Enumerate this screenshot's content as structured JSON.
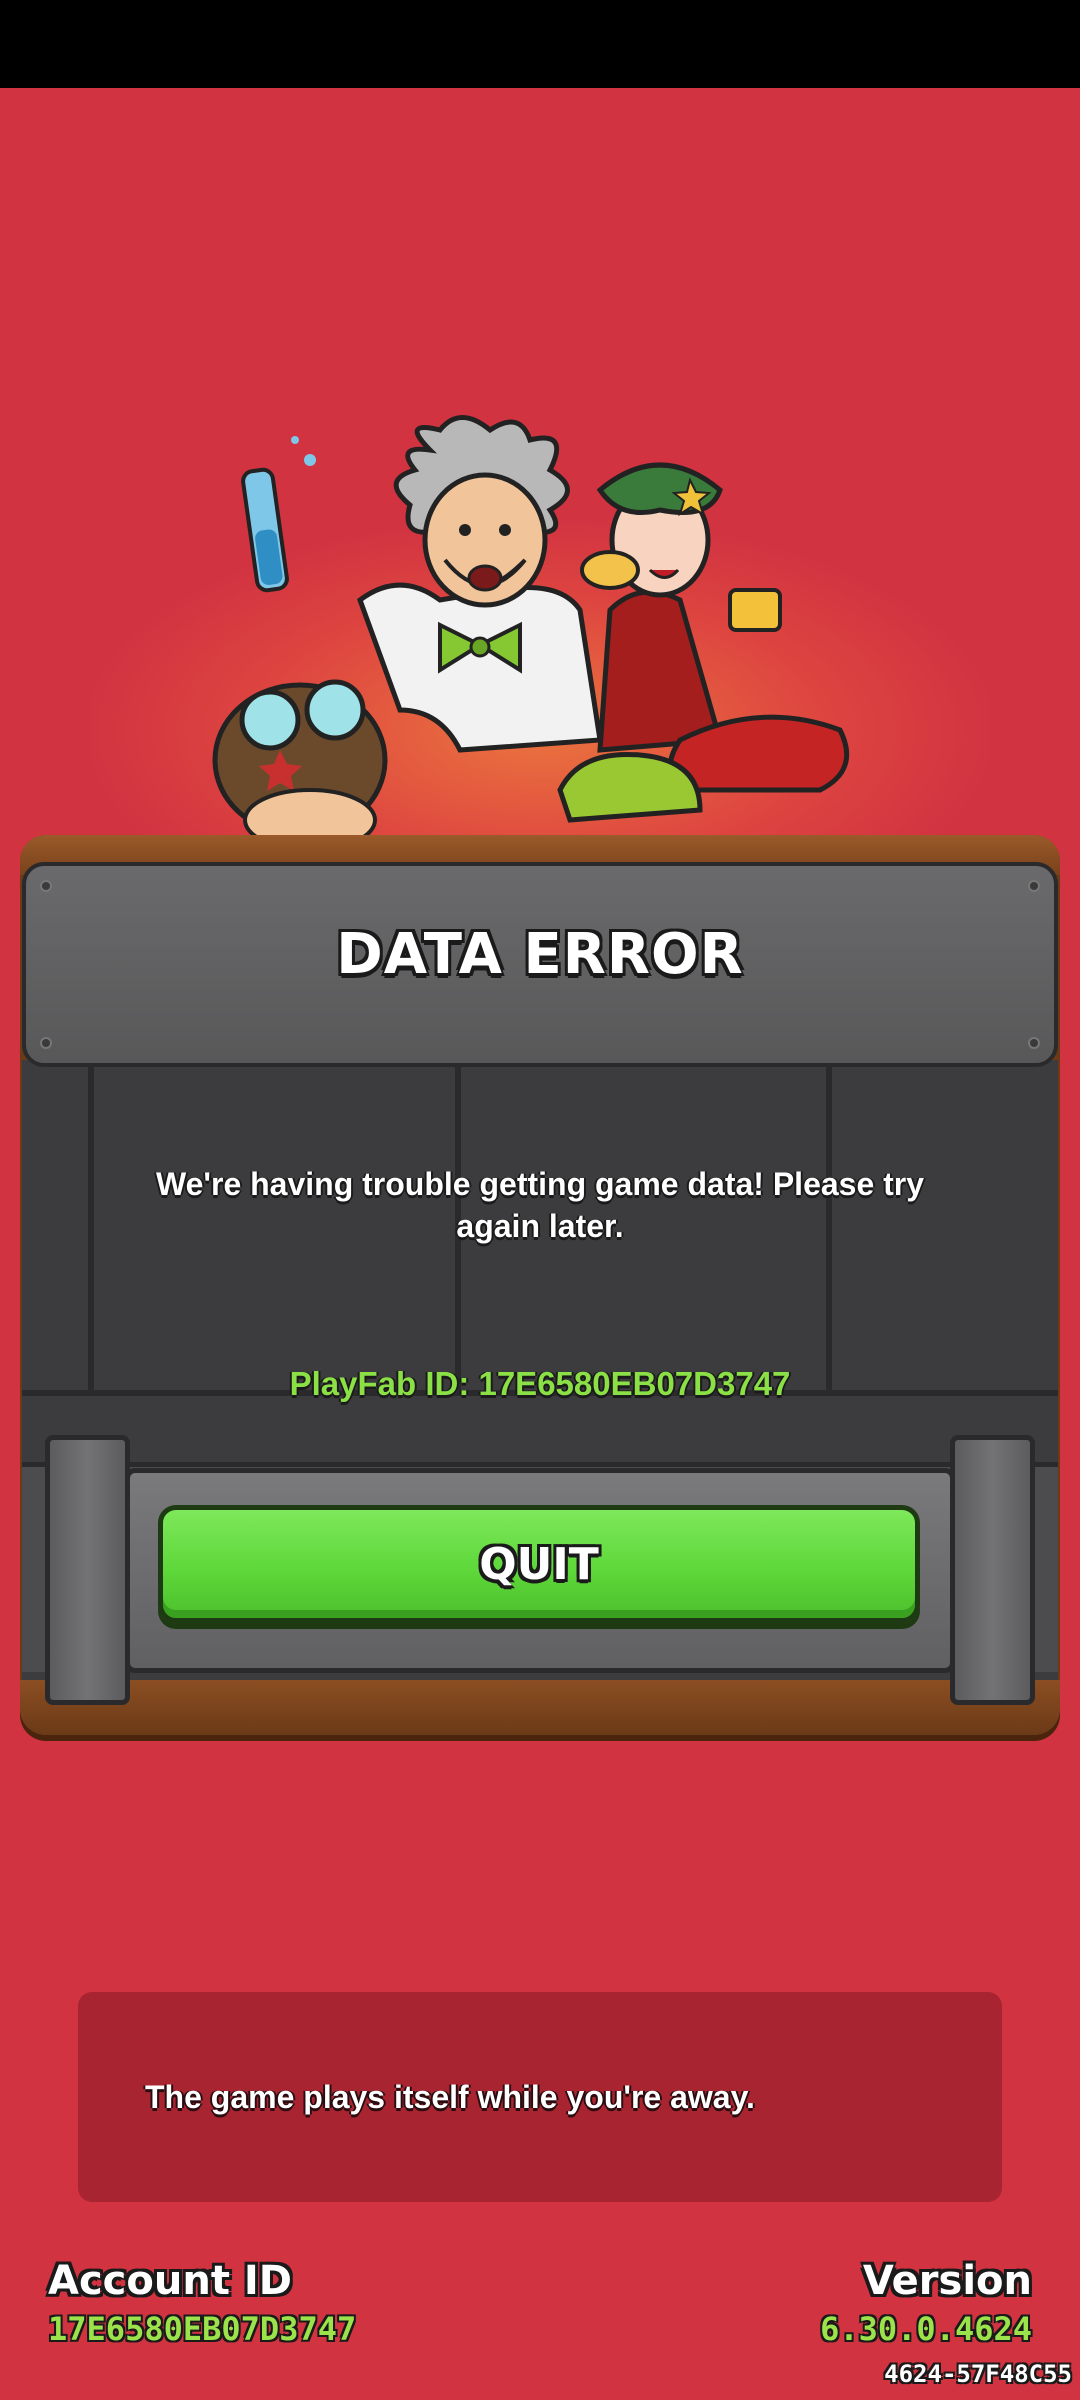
{
  "dialog": {
    "title": "DATA ERROR",
    "message": "We're having trouble getting game data!  Please try again later.",
    "playfab_id": "PlayFab ID: 17E6580EB07D3747",
    "quit_label": "QUIT"
  },
  "tip": {
    "text": "The game plays itself while you're away."
  },
  "footer": {
    "account_label": "Account ID",
    "account_value": "17E6580EB07D3747",
    "version_label": "Version",
    "version_value": "6.30.0.4624",
    "build_hash": "4624-57F48C55"
  },
  "colors": {
    "background": "#d23341",
    "accent_green": "#5ed83a",
    "id_green": "#8be046"
  },
  "illustration": {
    "icon": "characters-group-icon"
  }
}
